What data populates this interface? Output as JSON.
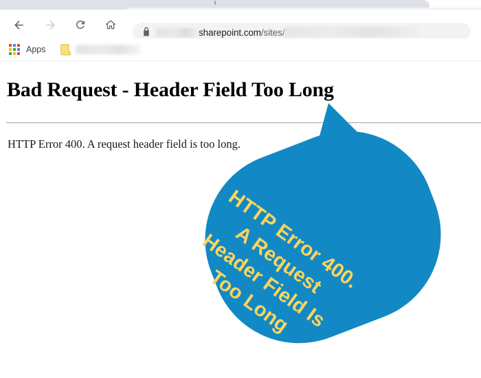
{
  "browser": {
    "nav": {
      "back_label": "Back",
      "forward_label": "Forward",
      "reload_label": "Reload",
      "home_label": "Home"
    },
    "omnibox": {
      "lock_icon": "lock-icon",
      "url_domain_suffix": "sharepoint.com",
      "url_path": "/sites/",
      "url_redacted_prefix": "",
      "url_redacted_suffix": ""
    },
    "bookmarks": {
      "apps_label": "Apps",
      "apps_icon": "apps-grid-icon",
      "folder_icon": "folder-icon",
      "folder_label": ""
    }
  },
  "page": {
    "heading": "Bad Request - Header Field Too Long",
    "body": "HTTP Error 400. A request header field is too long."
  },
  "annotation": {
    "bubble_color": "#1289c4",
    "text_color": "#fbd45c",
    "lines": [
      "HTTP Error 400.",
      "A Request",
      "Header Field Is",
      "Too Long"
    ]
  },
  "colors": {
    "apps_red": "#ea4335",
    "apps_blue": "#4285f4",
    "apps_green": "#34a853",
    "apps_yellow": "#fbbc05",
    "folder_yellow": "#fadf7f",
    "folder_border": "#e6c44f",
    "chrome_tab_bg": "#dee1e6",
    "omnibox_bg": "#f1f3f4"
  }
}
